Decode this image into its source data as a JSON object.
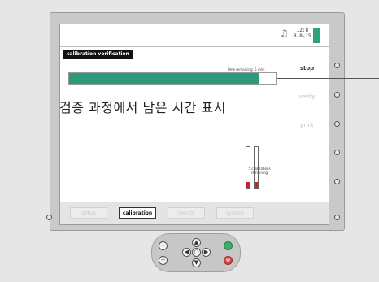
{
  "status": {
    "time": "12:8",
    "date": "8-8-15",
    "bell_icon": "bell-icon"
  },
  "screen": {
    "title": "calibration verification",
    "remaining_label": "time remaining: 5 min.",
    "progress_fraction": 0.92,
    "tube_caption": "5 calibrations remaining"
  },
  "annotation": "검증 과정에서 남은 시간 표시",
  "softkeys": [
    {
      "label": "stop",
      "active": true
    },
    {
      "label": "verify",
      "active": false
    },
    {
      "label": "print",
      "active": false
    }
  ],
  "tabs": [
    {
      "label": "setup",
      "active": false
    },
    {
      "label": "calibration",
      "active": true
    },
    {
      "label": "results",
      "active": false
    },
    {
      "label": "system",
      "active": false
    }
  ],
  "keypad": {
    "plus_icon": "plus-icon",
    "minus_icon": "minus-icon",
    "ok_icon": "green-ok-icon",
    "cancel_icon": "red-cancel-icon"
  },
  "colors": {
    "progress": "#2c9a7b",
    "tube_cap": "#c0272d",
    "indicator": "#2aa37d"
  }
}
